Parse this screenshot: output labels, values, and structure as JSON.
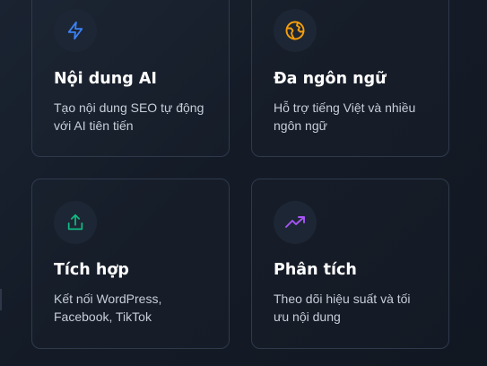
{
  "features": [
    {
      "title": "Nội dung AI",
      "description": [
        "Tạo nội dung SEO tự động",
        "với AI tiên tiến"
      ],
      "icon": "lightning-icon",
      "icon_color": "#3b82f6"
    },
    {
      "title": "Đa ngôn ngữ",
      "description": [
        "Hỗ trợ tiếng Việt và nhiều",
        "ngôn ngữ"
      ],
      "icon": "globe-icon",
      "icon_color": "#f59e0b"
    },
    {
      "title": "Tích hợp",
      "description": [
        "Kết nối WordPress,",
        "Facebook, TikTok"
      ],
      "icon": "share-icon",
      "icon_color": "#10b981"
    },
    {
      "title": "Phân tích",
      "description": [
        "Theo dõi hiệu suất và tối",
        "ưu nội dung"
      ],
      "icon": "trending-up-icon",
      "icon_color": "#a855f7"
    }
  ]
}
